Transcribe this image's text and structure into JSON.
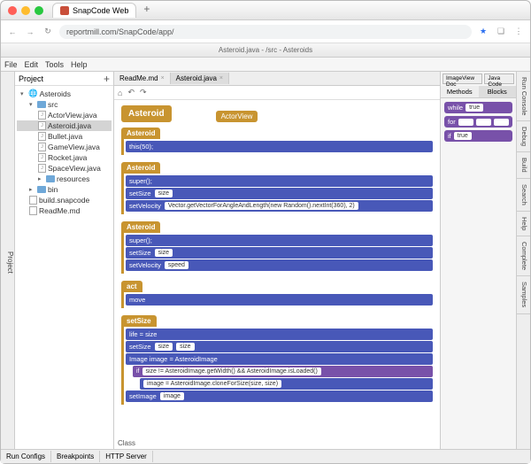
{
  "browser": {
    "tab_title": "SnapCode Web",
    "url": "reportmill.com/SnapCode/app/"
  },
  "app_title": "Asteroid.java - /src - Asteroids",
  "menubar": [
    "File",
    "Edit",
    "Tools",
    "Help"
  ],
  "sidebar_label": "Project",
  "project_header": "Project",
  "tree": {
    "root": "Asteroids",
    "src": "src",
    "files": [
      "ActorView.java",
      "Asteroid.java",
      "Bullet.java",
      "GameView.java",
      "Rocket.java",
      "SpaceView.java"
    ],
    "resources": "resources",
    "bin": "bin",
    "build": "build.snapcode",
    "readme": "ReadMe.md"
  },
  "filetabs": [
    {
      "name": "ReadMe.md",
      "active": false
    },
    {
      "name": "Asteroid.java",
      "active": true
    }
  ],
  "canvas": {
    "class_name": "Asteroid",
    "superclass": "ActorView",
    "sections": [
      {
        "title": "Asteroid",
        "rows": [
          {
            "call": "this(50);"
          }
        ]
      },
      {
        "title": "Asteroid",
        "rows": [
          {
            "call": "super();"
          },
          {
            "call": "setSize",
            "arg": "size"
          },
          {
            "call": "setVelocity",
            "arg": "Vector.getVectorForAngleAndLength(new Random().nextInt(360), 2)"
          }
        ]
      },
      {
        "title": "Asteroid",
        "rows": [
          {
            "call": "super();"
          },
          {
            "call": "setSize",
            "arg": "size"
          },
          {
            "call": "setVelocity",
            "arg": "speed"
          }
        ]
      },
      {
        "title": "act",
        "rows": [
          {
            "call": "move"
          }
        ]
      },
      {
        "title": "setSize",
        "rows": [
          {
            "call": "life = size"
          },
          {
            "call": "setSize",
            "arg": "size",
            "arg2": "size"
          },
          {
            "call": "Image image = AsteroidImage"
          },
          {
            "if": "size != AsteroidImage.getWidth() && AsteroidImage.isLoaded()",
            "then": "image = AsteroidImage.cloneForSize(size, size)"
          },
          {
            "call": "setImage",
            "arg": "image"
          }
        ]
      }
    ],
    "class_label": "Class"
  },
  "rightpanel": {
    "btn1": "ImageView Doc",
    "btn2": "Java Code",
    "tabs": [
      "Methods",
      "Blocks"
    ],
    "palette": [
      {
        "kw": "while",
        "arg": "true"
      },
      {
        "kw": "for"
      },
      {
        "kw": "if",
        "arg": "true"
      }
    ]
  },
  "righttabs": [
    "Run Console",
    "Debug",
    "Build",
    "Search",
    "Help",
    "Complete",
    "Samples"
  ],
  "bottombar": [
    "Run Configs",
    "Breakpoints",
    "HTTP Server"
  ]
}
